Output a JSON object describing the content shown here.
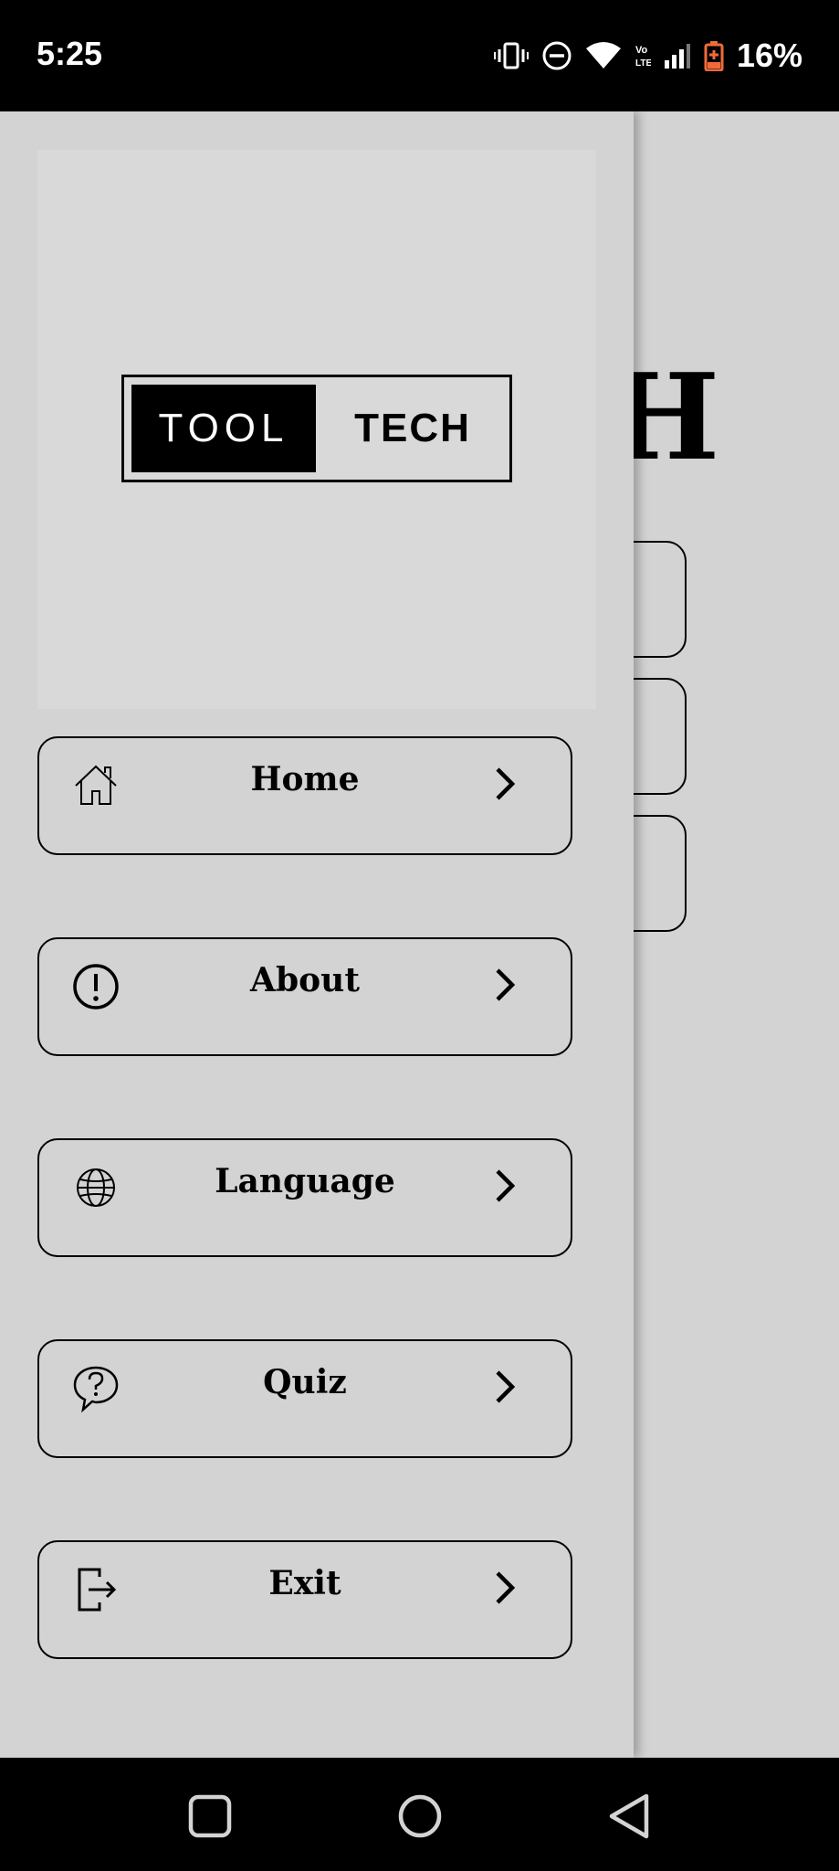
{
  "status": {
    "time": "5:25",
    "battery": "16%",
    "icons": [
      "vibrate-icon",
      "dnd-icon",
      "wifi-icon",
      "volte-icon",
      "signal-icon",
      "battery-icon"
    ]
  },
  "background": {
    "title_fragment": "CH"
  },
  "drawer": {
    "logo": {
      "left": "TOOL",
      "right": "TECH"
    },
    "items": [
      {
        "label": "Home",
        "icon": "home-icon"
      },
      {
        "label": "About",
        "icon": "info-icon"
      },
      {
        "label": "Language",
        "icon": "globe-icon"
      },
      {
        "label": "Quiz",
        "icon": "question-bubble-icon"
      },
      {
        "label": "Exit",
        "icon": "exit-icon"
      }
    ]
  },
  "nav": {
    "buttons": [
      "recents-button",
      "home-button",
      "back-button"
    ]
  },
  "colors": {
    "battery_accent": "#f06b3a",
    "background": "#d3d3d3",
    "panel": "#d9d9d9"
  }
}
